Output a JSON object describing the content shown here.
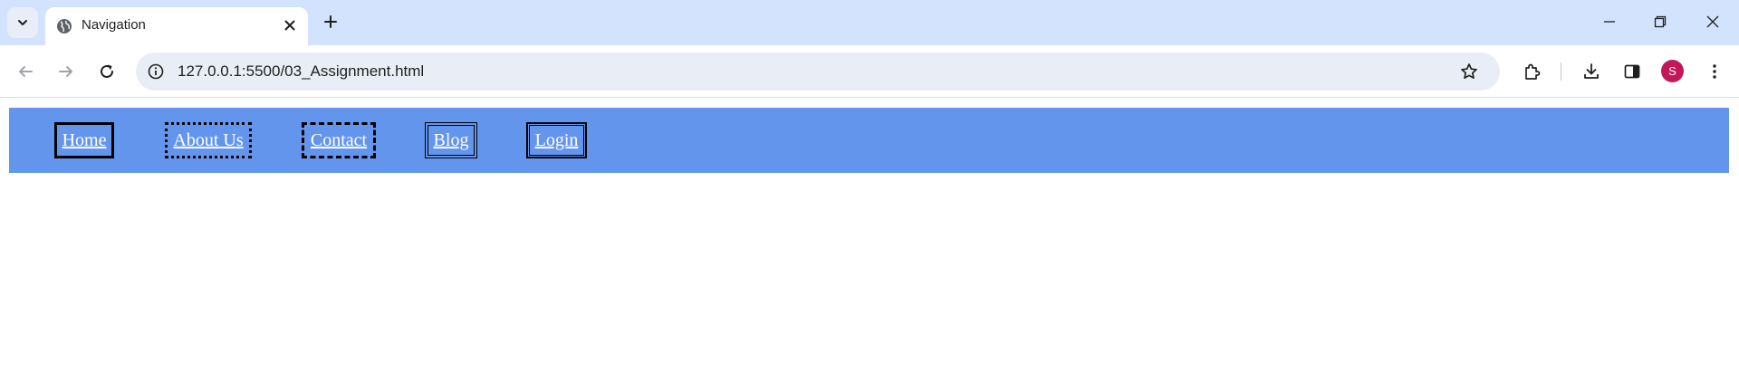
{
  "browser": {
    "tab": {
      "title": "Navigation",
      "favicon": "globe-icon"
    },
    "address_bar": {
      "url": "127.0.0.1:5500/03_Assignment.html"
    },
    "profile": {
      "initial": "S",
      "color": "#c2185b"
    },
    "colors": {
      "tabstrip": "#d3e3fd",
      "omnibox": "#e9eef6"
    }
  },
  "page": {
    "navbar": {
      "background": "cornflowerblue",
      "items": [
        {
          "label": "Home",
          "border": "solid"
        },
        {
          "label": "About Us",
          "border": "dotted"
        },
        {
          "label": "Contact",
          "border": "dashed"
        },
        {
          "label": "Blog",
          "border": "double"
        },
        {
          "label": "Login",
          "border": "solid-inner"
        }
      ]
    }
  }
}
